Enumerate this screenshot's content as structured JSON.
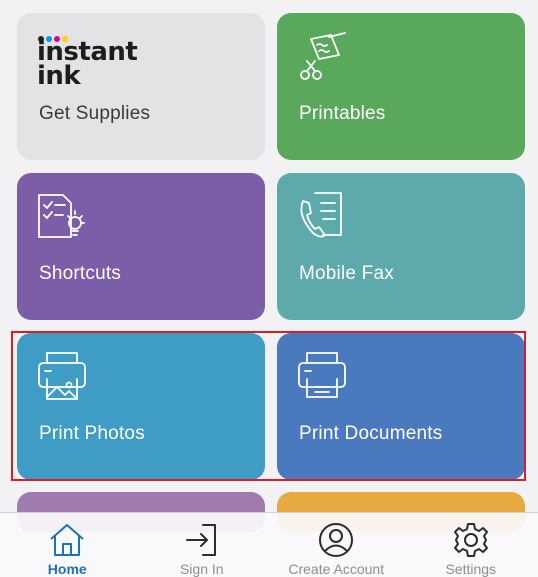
{
  "tiles": {
    "supplies": {
      "label": "Get Supplies",
      "logo_line1": "instant",
      "logo_line2": "ink"
    },
    "printables": {
      "label": "Printables"
    },
    "shortcuts": {
      "label": "Shortcuts"
    },
    "fax": {
      "label": "Mobile Fax"
    },
    "photos": {
      "label": "Print Photos"
    },
    "documents": {
      "label": "Print Documents"
    }
  },
  "icons": {
    "printables": "scissors-paper-icon",
    "shortcuts": "checklist-bulb-icon",
    "fax": "phone-document-icon",
    "photos": "photo-printer-icon",
    "documents": "document-printer-icon"
  },
  "colors": {
    "printables": "#5aa85c",
    "shortcuts": "#7b5ea7",
    "fax": "#5ea9aa",
    "photos": "#3f9cc4",
    "documents": "#4a79bd",
    "highlight": "#d61f26",
    "tab_active": "#1b72b8"
  },
  "tabbar": {
    "home": "Home",
    "signin": "Sign In",
    "account": "Create Account",
    "settings": "Settings"
  }
}
